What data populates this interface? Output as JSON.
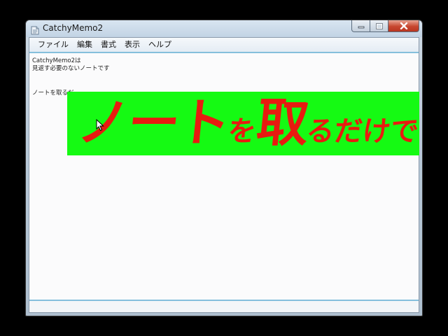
{
  "window": {
    "title": "CatchyMemo2",
    "icon": "notepad-icon"
  },
  "caption_buttons": {
    "minimize_icon": "minimize-icon",
    "maximize_icon": "maximize-icon",
    "close_icon": "close-icon",
    "close_color": "#c7462f"
  },
  "menu": {
    "items": [
      "ファイル",
      "編集",
      "書式",
      "表示",
      "ヘルプ"
    ]
  },
  "editor": {
    "lines": [
      "CatchyMemo2は",
      "見返す必要のないノートです",
      "ノートを取るだ"
    ]
  },
  "overlay": {
    "parts": [
      "ノート",
      "を",
      "取",
      "るだけで"
    ],
    "background_color": "#15fa13",
    "text_color": "#e81b10"
  },
  "cursor": "arrow-cursor-icon"
}
